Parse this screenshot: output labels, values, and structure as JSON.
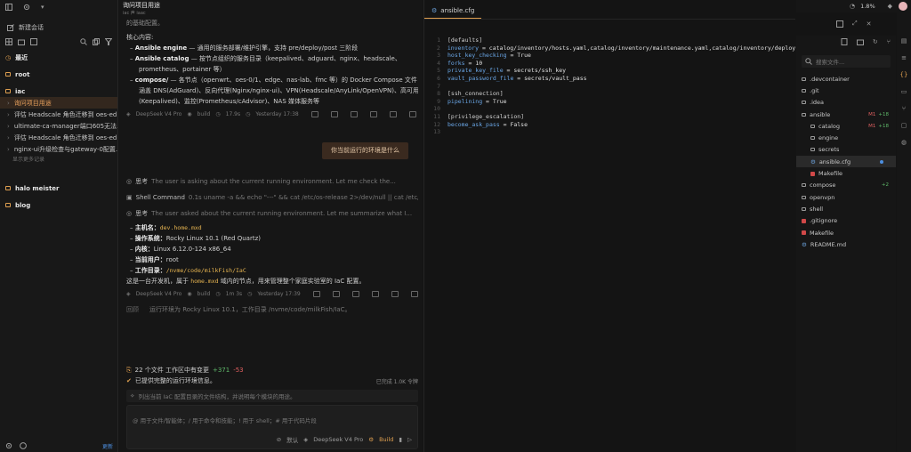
{
  "sidebar": {
    "new_chat": "新建会话",
    "recent": "最近",
    "items": [
      {
        "label": "root",
        "type": "folder"
      },
      {
        "label": "iac",
        "type": "folder"
      },
      {
        "label": "询问项目用途",
        "type": "active"
      },
      {
        "label": "评估 Headscale 角色迁移到 oes-ed...",
        "type": "sub"
      },
      {
        "label": "ultimate-ca-manager端口605无法...",
        "type": "sub"
      },
      {
        "label": "评估 Headscale 角色迁移到 oes-ed...",
        "type": "sub"
      },
      {
        "label": "nginx-ui升级检查与gateway-0配置...",
        "type": "sub"
      },
      {
        "label": "显示更多记录",
        "type": "muted"
      },
      {
        "label": "halo meister",
        "type": "folder"
      },
      {
        "label": "blog",
        "type": "folder"
      }
    ],
    "update_label": "更新"
  },
  "chat": {
    "title": "询问项目用途",
    "subtitle": "iac 声 iaac",
    "intro_fragment": "的基础配置。",
    "core_heading": "核心内容:",
    "bullets": [
      {
        "bold": "Ansible engine",
        "text": " — 通用的服务部署/维护引擎，支持 pre/deploy/post 三阶段"
      },
      {
        "bold": "Ansible catalog",
        "text": " — 按节点组织的服务目录（keepalived、adguard、nginx、headscale、"
      },
      {
        "bold": "",
        "text": "prometheus、portainer 等）"
      },
      {
        "bold": "compose/",
        "text": " — 各节点（openwrt、oes-0/1、edge、nas-lab、fmc 等）的 Docker Compose 文件"
      },
      {
        "bold": "",
        "text": "涵盖 DNS(AdGuard)、反向代理(Nginx/nginx-ui)、VPN(Headscale/AnyLink/OpenVPN)、高可用"
      },
      {
        "bold": "",
        "text": "(Keepalived)、监控(Prometheus/cAdvisor)、NAS 媒体服务等"
      }
    ],
    "meta1": {
      "model": "DeepSeek V4 Pro",
      "mode": "build",
      "duration": "17.9s",
      "time": "Yesterday 17:38"
    },
    "user_message": "你当前运行的环境是什么",
    "think1": {
      "label": "思考",
      "text": "The user is asking about the current running environment. Let me check the..."
    },
    "shell": {
      "label": "Shell Command",
      "text": "0.1s  uname -a && echo \"---\" && cat /etc/os-release 2>/dev/null || cat /etc/fsb-release 2..."
    },
    "think2": {
      "label": "思考",
      "text": "The user asked about the current running environment. Let me summarize what I..."
    },
    "env": [
      {
        "label": "主机名",
        "value": "dev.home.mxd",
        "code": true
      },
      {
        "label": "操作系统",
        "value": "Rocky Linux 10.1 (Red Quartz)",
        "code": false
      },
      {
        "label": "内核",
        "value": "Linux 6.12.0-124 x86_64",
        "code": false
      },
      {
        "label": "当前用户",
        "value": "root",
        "code": false
      },
      {
        "label": "工作目录",
        "value": "/nvme/code/milkFish/IaC",
        "code": true
      }
    ],
    "summary_pre": "这是一台开发机，属于 ",
    "summary_code": "home.mxd",
    "summary_post": " 域内的节点，用来管理整个家庭实验室的 IaC 配置。",
    "meta2": {
      "model": "DeepSeek V4 Pro",
      "mode": "build",
      "duration": "1m 3s",
      "time": "Yesterday 17:39"
    },
    "recap_label": "回顾",
    "recap_text": "运行环境为 Rocky Linux 10.1，工作目录 /nvme/code/milkFish/IaC。"
  },
  "composer": {
    "changes_text": "22 个文件 工作区中有变更",
    "added": "+371",
    "removed": "-53",
    "status_text": "已提供完整的运行环境信息。",
    "status_right": "已完成  1.0K 令牌",
    "suggestion": "列出当前 IaC 配置目录的文件结构，并说明每个模块的用途。",
    "placeholder": "@ 用于文件/智能体；/ 用于命令和技能；! 用于 shell；# 用于代码片段",
    "default_label": "默认",
    "model": "DeepSeek V4 Pro",
    "build": "Build"
  },
  "editor": {
    "tab": "ansible.cfg",
    "lines": [
      {
        "n": "1",
        "parts": [
          {
            "c": "sec",
            "t": "[defaults]"
          }
        ]
      },
      {
        "n": "2",
        "parts": [
          {
            "c": "key",
            "t": "inventory"
          },
          {
            "c": "val",
            "t": " = catalog/inventory/hosts.yaml,catalog/inventory/maintenance.yaml,catalog/inventory/deploy."
          }
        ]
      },
      {
        "n": "3",
        "parts": [
          {
            "c": "key",
            "t": "host_key_checking"
          },
          {
            "c": "val",
            "t": " = True"
          }
        ]
      },
      {
        "n": "4",
        "parts": [
          {
            "c": "key",
            "t": "forks"
          },
          {
            "c": "val",
            "t": " = 10"
          }
        ]
      },
      {
        "n": "5",
        "parts": [
          {
            "c": "key",
            "t": "private_key_file"
          },
          {
            "c": "val",
            "t": " = secrets/ssh_key"
          }
        ]
      },
      {
        "n": "6",
        "parts": [
          {
            "c": "key",
            "t": "vault_password_file"
          },
          {
            "c": "val",
            "t": " = secrets/vault_pass"
          }
        ]
      },
      {
        "n": "7",
        "parts": []
      },
      {
        "n": "8",
        "parts": [
          {
            "c": "sec",
            "t": "[ssh_connection]"
          }
        ]
      },
      {
        "n": "9",
        "parts": [
          {
            "c": "key",
            "t": "pipelining"
          },
          {
            "c": "val",
            "t": " = True"
          }
        ]
      },
      {
        "n": "10",
        "parts": []
      },
      {
        "n": "11",
        "parts": [
          {
            "c": "sec",
            "t": "[privilege_escalation]"
          }
        ]
      },
      {
        "n": "12",
        "parts": [
          {
            "c": "key",
            "t": "become_ask_pass"
          },
          {
            "c": "val",
            "t": " = False"
          }
        ]
      },
      {
        "n": "13",
        "parts": []
      }
    ]
  },
  "topbar": {
    "percent": "1.8%"
  },
  "tree": {
    "search_placeholder": "搜索文件...",
    "items": [
      {
        "label": ".devcontainer",
        "level": 0
      },
      {
        "label": ".git",
        "level": 0
      },
      {
        "label": ".idea",
        "level": 0
      },
      {
        "label": "ansible",
        "level": 0,
        "badge": "M1",
        "plus": "+18"
      },
      {
        "label": "catalog",
        "level": 1,
        "badge": "M1",
        "plus": "+18"
      },
      {
        "label": "engine",
        "level": 1
      },
      {
        "label": "secrets",
        "level": 1
      },
      {
        "label": "ansible.cfg",
        "level": 1,
        "selected": true,
        "dot": true
      },
      {
        "label": "Makefile",
        "level": 1,
        "red": true
      },
      {
        "label": "compose",
        "level": 0,
        "plus": "+2"
      },
      {
        "label": "openvpn",
        "level": 0
      },
      {
        "label": "shell",
        "level": 0
      },
      {
        "label": ".gitignore",
        "level": 0,
        "red": true
      },
      {
        "label": "Makefile",
        "level": 0,
        "red": true
      },
      {
        "label": "README.md",
        "level": 0
      }
    ]
  }
}
